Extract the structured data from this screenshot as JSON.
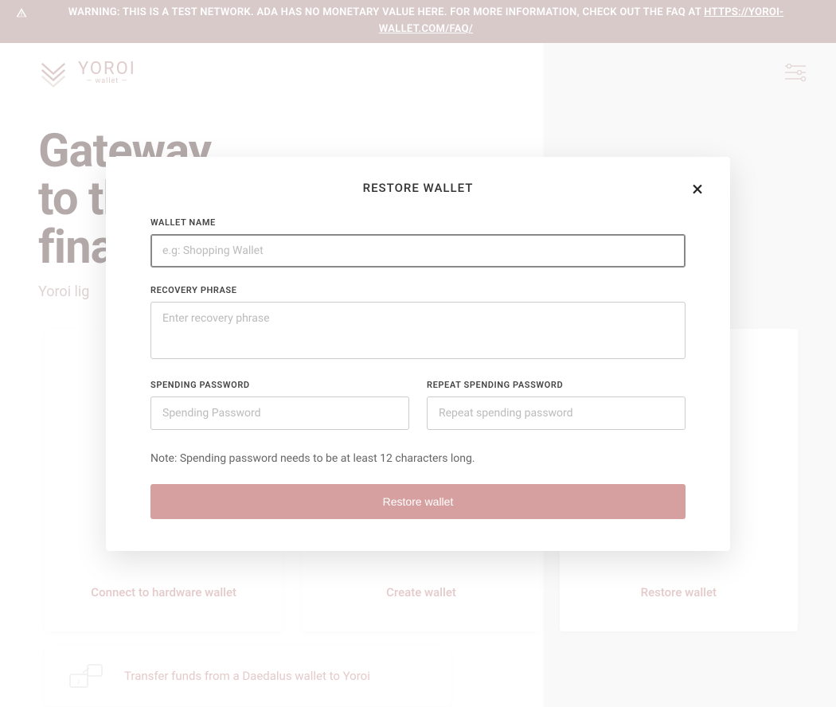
{
  "banner": {
    "text": "WARNING: THIS IS A TEST NETWORK. ADA HAS NO MONETARY VALUE HERE. FOR MORE INFORMATION, CHECK OUT THE FAQ AT ",
    "link": "HTTPS://YOROI-WALLET.COM/FAQ/"
  },
  "brand": {
    "name": "YOROI",
    "sub": "wallet"
  },
  "hero": {
    "line1": "Gateway",
    "line2": "to the",
    "line3": "financial world",
    "subtitle": "Yoroi lig"
  },
  "cards": {
    "hardware": "Connect to hardware wallet",
    "create": "Create wallet",
    "restore": "Restore wallet",
    "transfer": "Transfer funds from a Daedalus wallet to Yoroi"
  },
  "modal": {
    "title": "RESTORE WALLET",
    "wallet_name_label": "WALLET NAME",
    "wallet_name_placeholder": "e.g: Shopping Wallet",
    "recovery_label": "RECOVERY PHRASE",
    "recovery_placeholder": "Enter recovery phrase",
    "spend_label": "SPENDING PASSWORD",
    "spend_placeholder": "Spending Password",
    "repeat_label": "REPEAT SPENDING PASSWORD",
    "repeat_placeholder": "Repeat spending password",
    "note": "Note: Spending password needs to be at least 12 characters long.",
    "button": "Restore wallet"
  },
  "colors": {
    "accent_pink": "#d6a0a0",
    "brand_muted": "#b89090",
    "text_dark": "#5a4444"
  }
}
